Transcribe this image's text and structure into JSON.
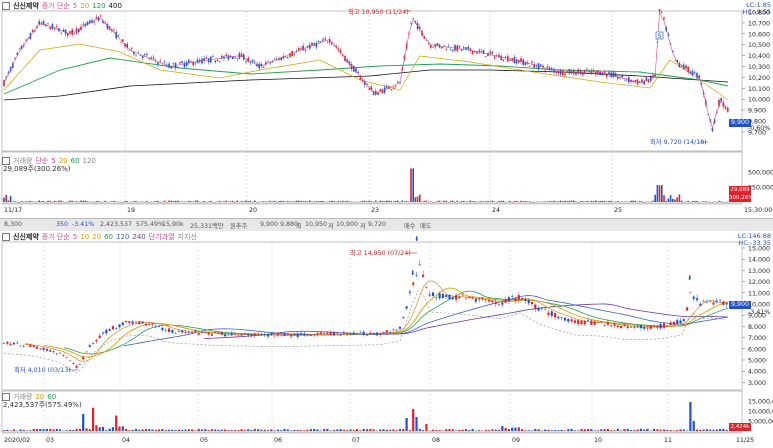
{
  "top": {
    "title": "신신제약",
    "indicator_name": "종가 단순",
    "ma_periods": [
      "5",
      "20",
      "120",
      "400"
    ],
    "lc_label": "LC:1.85",
    "hc_label": "HC:-9.55",
    "price_ticks": [
      "10,800",
      "10,700",
      "10,600",
      "10,500",
      "10,400",
      "10,300",
      "10,200",
      "10,100",
      "10,000",
      "9,900",
      "9,800",
      "9,700"
    ],
    "current_price": "9,900",
    "current_change": "-0.60%",
    "high_annotation": "최고 10,950 (11/24)",
    "low_annotation": "최저 9,720 (14/18)",
    "date_labels": [
      "11/17",
      "19",
      "20",
      "23",
      "24",
      "25"
    ],
    "time_end": "15:30:00",
    "volume": {
      "title": "거래량",
      "indicator_name": "단순",
      "ma_periods": [
        "5",
        "20",
        "60",
        "120"
      ],
      "value_label": "29,089주(300.26%)",
      "ticks": [
        "500,000",
        "250,000"
      ],
      "current_value": "29,089",
      "current_pct": "300.26%"
    }
  },
  "midbar": {
    "items": [
      "8,300",
      "350",
      "-3.41%",
      "2,423,537",
      "575.49%",
      "15,90k",
      "25,331백만",
      "원추주",
      "9,900",
      "9,880",
      "최",
      "10,950",
      "저",
      "10,900",
      "저",
      "9,720",
      "매수",
      "매도"
    ]
  },
  "bottom": {
    "title": "신신제약",
    "indicator_name": "종가 단순",
    "ma_periods": [
      "5",
      "10",
      "20",
      "60",
      "120",
      "240"
    ],
    "extra_labels": [
      "단기과열",
      "지지선"
    ],
    "lc_label": "LC:146.88",
    "hc_label": "HC:-33.35",
    "price_ticks": [
      "15,000",
      "14,000",
      "13,000",
      "12,000",
      "11,000",
      "10,000",
      "9,000",
      "8,000",
      "7,000",
      "6,000",
      "5,000",
      "4,000",
      "3,000"
    ],
    "current_price": "9,900",
    "current_change": "-3.41%",
    "high_annotation": "최고 14,950 (07/24)",
    "low_annotation": "최저 4,010 (03/13)",
    "date_labels": [
      "2020/02",
      "03",
      "04",
      "05",
      "06",
      "07",
      "08",
      "09",
      "10",
      "11",
      "11/25"
    ],
    "volume": {
      "title": "거래량",
      "ma_periods": [
        "20",
        "60"
      ],
      "value_label": "2,423,537주(575.49%)",
      "ticks": [
        "15,000,000",
        "10,000,000",
        "5,000,000"
      ],
      "current_value": "2,424k",
      "current_pct": "575.49%"
    }
  },
  "colors": {
    "up": "#e0202a",
    "down": "#2050d0",
    "ma5": "#d04a9a",
    "ma20": "#d3a300",
    "ma60": "#20a050",
    "ma120": "#3a62c9",
    "ma240": "#6a3aa8",
    "ma400": "#111111"
  }
}
